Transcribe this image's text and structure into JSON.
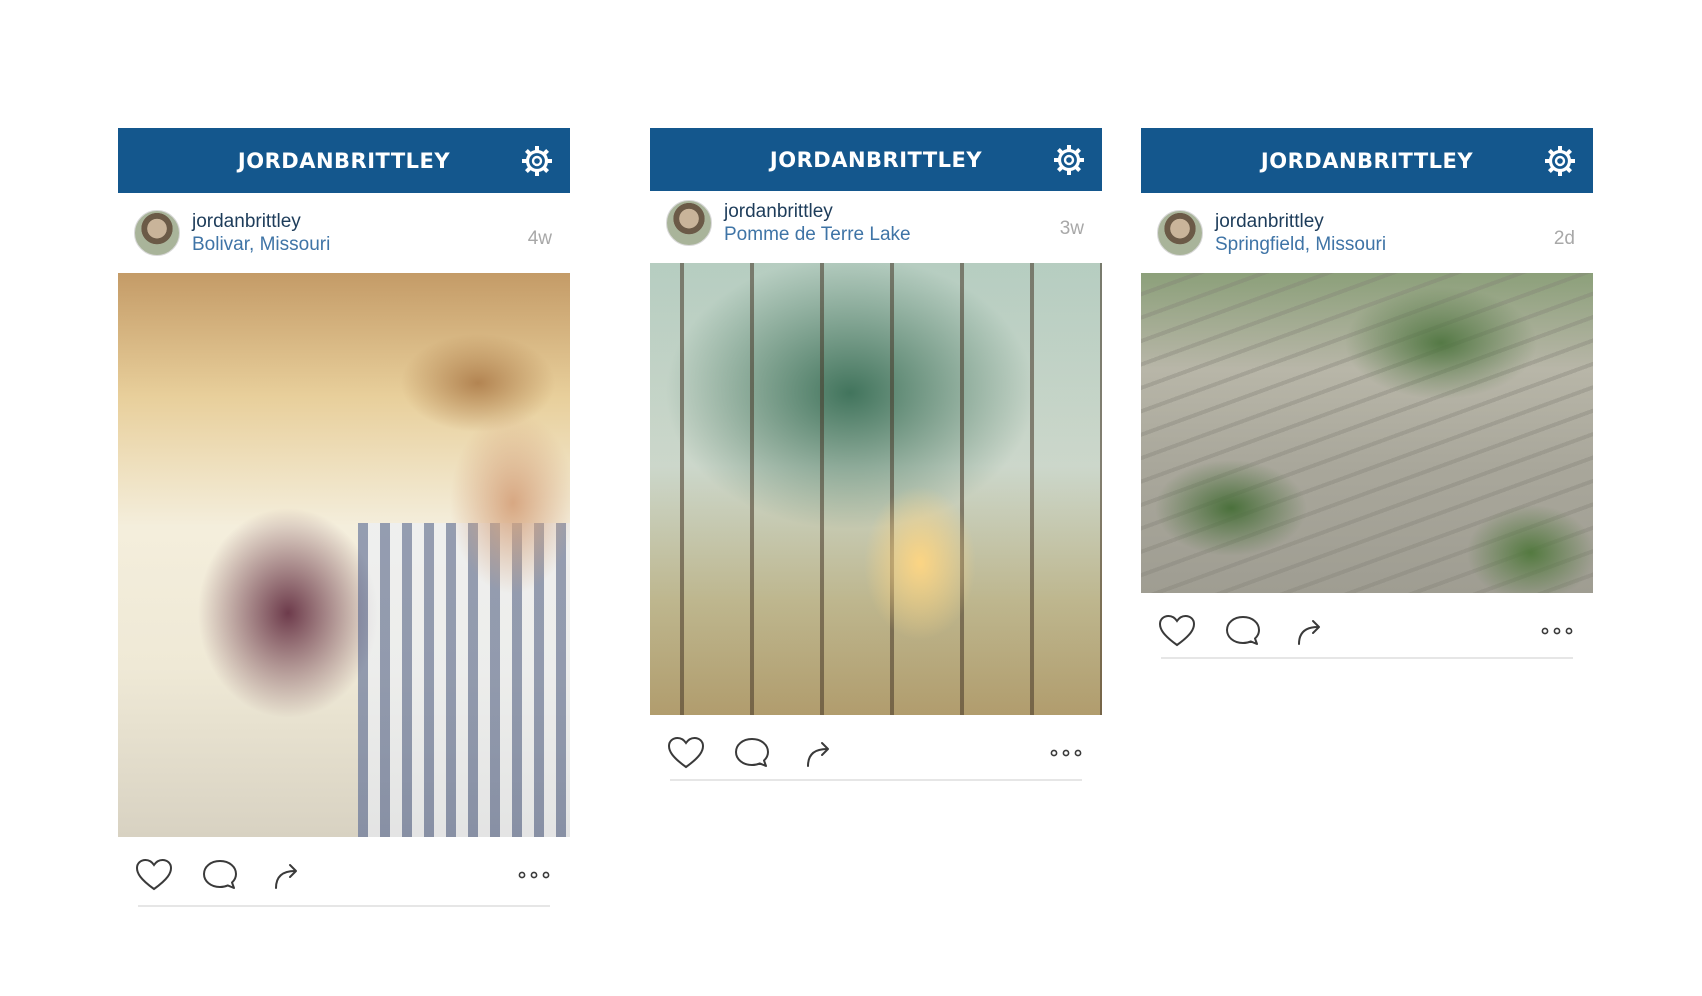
{
  "posts": [
    {
      "header_title": "JORDANBRITTLEY",
      "username": "jordanbrittley",
      "location": "Bolivar, Missouri",
      "time": "4w",
      "photo": "couple-in-truck"
    },
    {
      "header_title": "JORDANBRITTLEY",
      "username": "jordanbrittley",
      "location": "Pomme de Terre Lake",
      "time": "3w",
      "photo": "couple-in-forest"
    },
    {
      "header_title": "JORDANBRITTLEY",
      "username": "jordanbrittley",
      "location": "Springfield, Missouri",
      "time": "2d",
      "photo": "couple-on-stone-stairs"
    }
  ],
  "icons": {
    "settings": "gear-icon",
    "like": "heart-icon",
    "comment": "comment-bubble-icon",
    "share": "share-arrow-icon",
    "more": "more-dots-icon"
  },
  "colors": {
    "header_bar": "#14578d",
    "username": "#1d3c5a",
    "location": "#3f74a6",
    "timestamp": "#a8a8a8"
  }
}
